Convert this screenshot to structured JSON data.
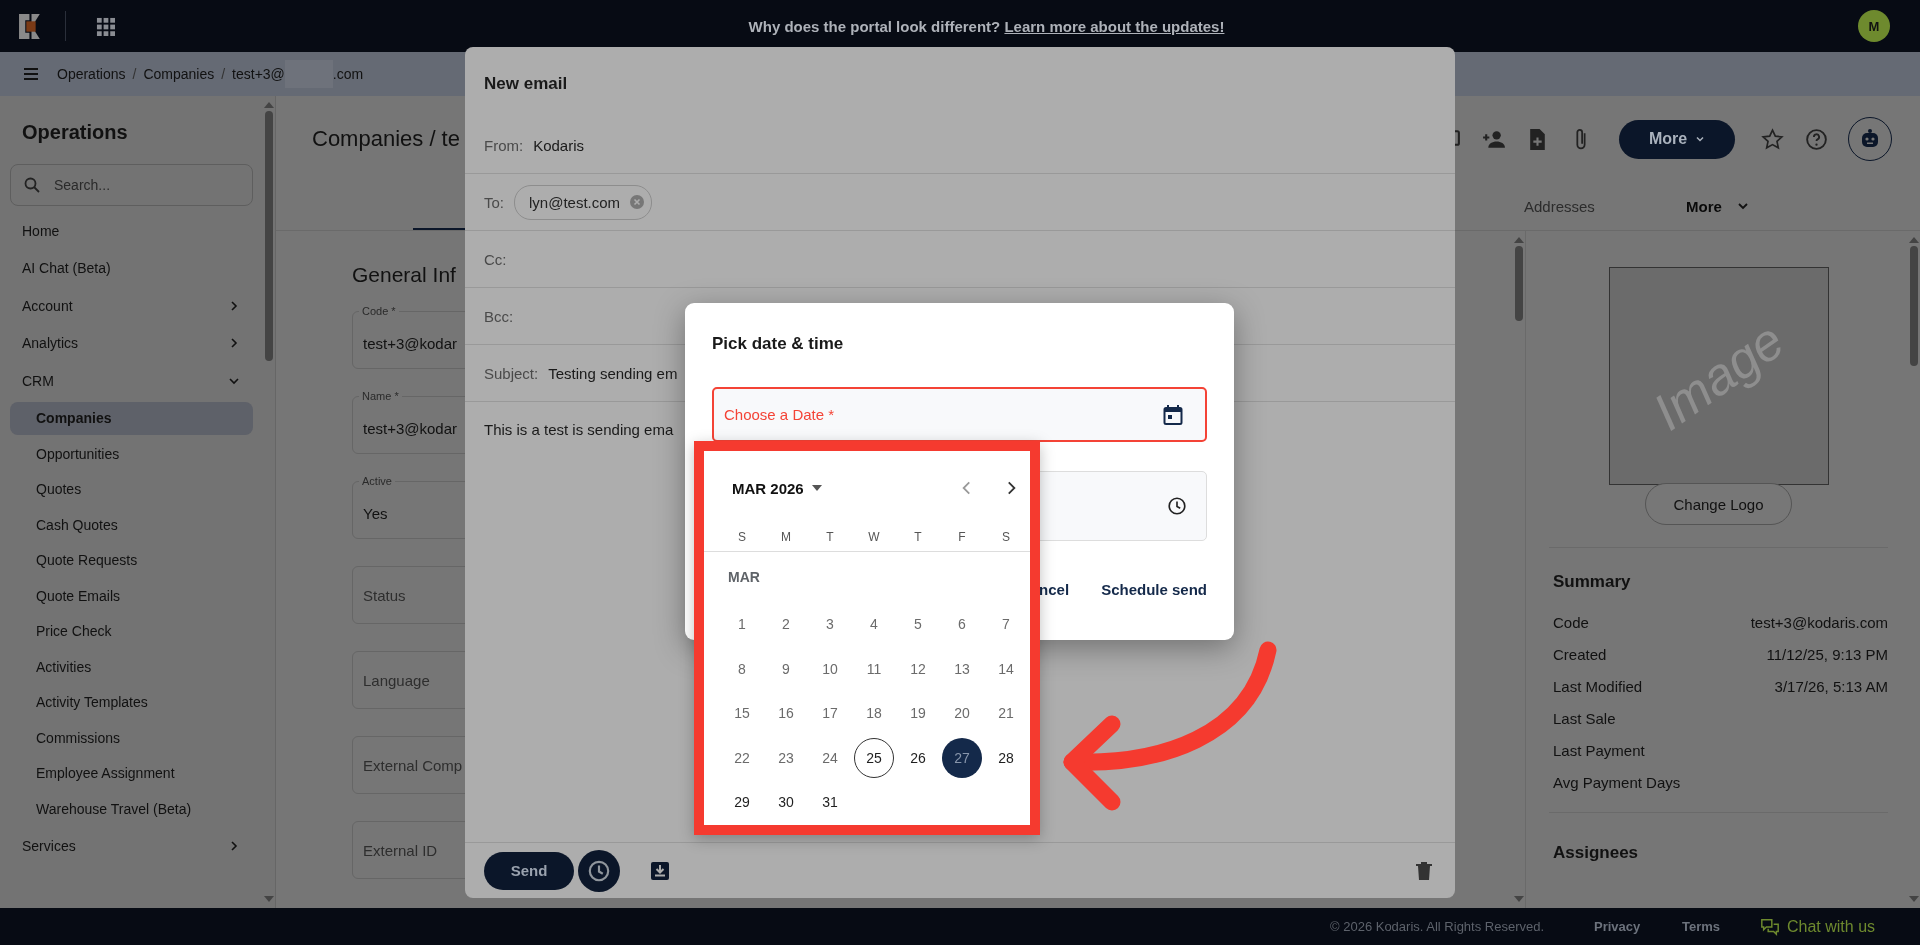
{
  "top_bar": {
    "banner": "Why does the portal look different? ",
    "banner_link": "Learn more about the updates!",
    "avatar": "M"
  },
  "breadcrumb": {
    "items": [
      {
        "label": "Operations",
        "separator": "/"
      },
      {
        "label": "Companies",
        "separator": "/"
      }
    ],
    "current_start": "test+3@",
    "current_end": ".com"
  },
  "sidebar": {
    "title": "Operations",
    "search": {
      "placeholder": "Search..."
    },
    "items": [
      {
        "label": "Home"
      },
      {
        "label": "AI Chat (Beta)"
      },
      {
        "label": "Account",
        "expanded": false
      },
      {
        "label": "Analytics",
        "expanded": false
      },
      {
        "label": "CRM",
        "expanded": true,
        "children": [
          {
            "label": "Companies",
            "selected": true
          },
          {
            "label": "Opportunities",
            "selected": false
          },
          {
            "label": "Quotes",
            "selected": false
          },
          {
            "label": "Cash Quotes",
            "selected": false
          },
          {
            "label": "Quote Requests",
            "selected": false
          },
          {
            "label": "Quote Emails",
            "selected": false
          },
          {
            "label": "Price Check",
            "selected": false
          },
          {
            "label": "Activities",
            "selected": false
          },
          {
            "label": "Activity Templates",
            "selected": false
          },
          {
            "label": "Commissions",
            "selected": false
          },
          {
            "label": "Employee Assignment",
            "selected": false
          },
          {
            "label": "Warehouse Travel (Beta)",
            "selected": false
          }
        ]
      },
      {
        "label": "Services",
        "expanded": false
      }
    ]
  },
  "page": {
    "title": "Companies / te",
    "more_button": "More",
    "tabs": [
      {
        "label": "Addresses",
        "selected": false,
        "kind": "link"
      },
      {
        "label": "More",
        "selected": false,
        "kind": "menu"
      }
    ]
  },
  "form": {
    "heading": "General Inf",
    "fields": [
      {
        "label": "Code *",
        "value": "test+3@kodar"
      },
      {
        "label": "Name *",
        "value": "test+3@kodar"
      },
      {
        "label": "Active",
        "value": "Yes"
      },
      {
        "placeholder": "Status"
      },
      {
        "placeholder": "Language"
      },
      {
        "placeholder": "External Comp"
      },
      {
        "placeholder": "External ID"
      }
    ]
  },
  "side_panel": {
    "image_text": "Image",
    "change_logo": "Change Logo",
    "summary_title": "Summary",
    "summary": [
      {
        "label": "Code",
        "value": "test+3@kodaris.com"
      },
      {
        "label": "Created",
        "value": "11/12/25, 9:13 PM"
      },
      {
        "label": "Last Modified",
        "value": "3/17/26, 5:13 AM"
      },
      {
        "label": "Last Sale"
      },
      {
        "label": "Last Payment"
      },
      {
        "label": "Avg Payment Days"
      }
    ],
    "assignees_title": "Assignees"
  },
  "footer": {
    "copyright": "© 2026 Kodaris. All Rights Reserved.",
    "links": [
      "Privacy",
      "Terms"
    ],
    "chat": "Chat with us"
  },
  "email": {
    "title": "New email",
    "rows": [
      {
        "label": "From:",
        "value": "Kodaris"
      },
      {
        "label": "To:",
        "chips": [
          "lyn@test.com"
        ]
      },
      {
        "label": "Cc:"
      },
      {
        "label": "Bcc:"
      },
      {
        "label": "Subject:",
        "value": "Testing sending em"
      }
    ],
    "body": "This is a test is sending ema",
    "send": "Send"
  },
  "schedule": {
    "title": "Pick date & time",
    "date_field": {
      "placeholder": "Choose a Date *",
      "invalid": true
    },
    "cancel": "ncel",
    "confirm": "Schedule send"
  },
  "calendar": {
    "month_year": "MAR 2026",
    "weekdays": [
      "S",
      "M",
      "T",
      "W",
      "T",
      "F",
      "S"
    ],
    "month_label": "MAR",
    "days": [
      {
        "label": "1",
        "disabled": true,
        "today": false,
        "selected": false
      },
      {
        "label": "2",
        "disabled": true,
        "today": false,
        "selected": false
      },
      {
        "label": "3",
        "disabled": true,
        "today": false,
        "selected": false
      },
      {
        "label": "4",
        "disabled": true,
        "today": false,
        "selected": false
      },
      {
        "label": "5",
        "disabled": true,
        "today": false,
        "selected": false
      },
      {
        "label": "6",
        "disabled": true,
        "today": false,
        "selected": false
      },
      {
        "label": "7",
        "disabled": true,
        "today": false,
        "selected": false
      },
      {
        "label": "8",
        "disabled": true,
        "today": false,
        "selected": false
      },
      {
        "label": "9",
        "disabled": true,
        "today": false,
        "selected": false
      },
      {
        "label": "10",
        "disabled": true,
        "today": false,
        "selected": false
      },
      {
        "label": "11",
        "disabled": true,
        "today": false,
        "selected": false
      },
      {
        "label": "12",
        "disabled": true,
        "today": false,
        "selected": false
      },
      {
        "label": "13",
        "disabled": true,
        "today": false,
        "selected": false
      },
      {
        "label": "14",
        "disabled": true,
        "today": false,
        "selected": false
      },
      {
        "label": "15",
        "disabled": true,
        "today": false,
        "selected": false
      },
      {
        "label": "16",
        "disabled": true,
        "today": false,
        "selected": false
      },
      {
        "label": "17",
        "disabled": true,
        "today": false,
        "selected": false
      },
      {
        "label": "18",
        "disabled": true,
        "today": false,
        "selected": false
      },
      {
        "label": "19",
        "disabled": true,
        "today": false,
        "selected": false
      },
      {
        "label": "20",
        "disabled": true,
        "today": false,
        "selected": false
      },
      {
        "label": "21",
        "disabled": true,
        "today": false,
        "selected": false
      },
      {
        "label": "22",
        "disabled": true,
        "today": false,
        "selected": false
      },
      {
        "label": "23",
        "disabled": true,
        "today": false,
        "selected": false
      },
      {
        "label": "24",
        "disabled": true,
        "today": false,
        "selected": false
      },
      {
        "label": "25",
        "disabled": false,
        "today": true,
        "selected": false
      },
      {
        "label": "26",
        "disabled": false,
        "today": false,
        "selected": false
      },
      {
        "label": "27",
        "disabled": false,
        "today": false,
        "selected": true
      },
      {
        "label": "28",
        "disabled": false,
        "today": false,
        "selected": false
      },
      {
        "label": "29",
        "disabled": false,
        "today": false,
        "selected": false
      },
      {
        "label": "30",
        "disabled": false,
        "today": false,
        "selected": false
      },
      {
        "label": "31",
        "disabled": false,
        "today": false,
        "selected": false
      }
    ]
  }
}
